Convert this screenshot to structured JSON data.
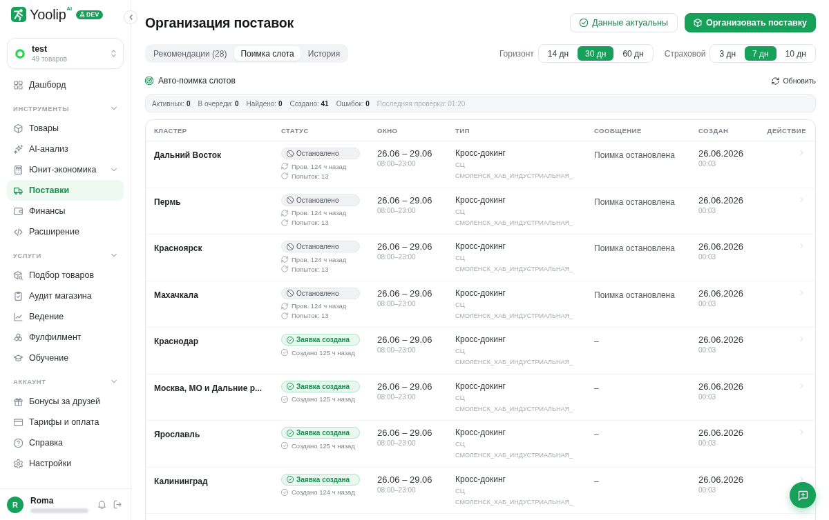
{
  "sidebar": {
    "brand": {
      "name": "Yoolip",
      "superscript": "AI",
      "badge": "DEV"
    },
    "workspace": {
      "name": "test",
      "subtitle": "49 товаров"
    },
    "nav": [
      {
        "kind": "link",
        "label": "Дашборд",
        "selected": false,
        "submenu": false
      },
      {
        "kind": "section",
        "title": "ИНСТРУМЕНТЫ",
        "expanded": true,
        "children": [
          {
            "label": "Товары",
            "selected": false,
            "submenu": false
          },
          {
            "label": "AI-анализ",
            "selected": false,
            "submenu": false
          },
          {
            "label": "Юнит-экономика",
            "selected": false,
            "submenu": true
          },
          {
            "label": "Поставки",
            "selected": true,
            "submenu": false
          },
          {
            "label": "Финансы",
            "selected": false,
            "submenu": false
          },
          {
            "label": "Расширение",
            "selected": false,
            "submenu": false
          }
        ]
      },
      {
        "kind": "section",
        "title": "УСЛУГИ",
        "expanded": true,
        "children": [
          {
            "label": "Подбор товаров",
            "selected": false,
            "submenu": false
          },
          {
            "label": "Аудит магазина",
            "selected": false,
            "submenu": false
          },
          {
            "label": "Ведение",
            "selected": false,
            "submenu": false
          },
          {
            "label": "Фулфилмент",
            "selected": false,
            "submenu": false
          },
          {
            "label": "Обучение",
            "selected": false,
            "submenu": false
          }
        ]
      },
      {
        "kind": "section",
        "title": "АККАУНТ",
        "expanded": true,
        "children": [
          {
            "label": "Бонусы за друзей",
            "selected": false,
            "submenu": false
          },
          {
            "label": "Тарифы и оплата",
            "selected": false,
            "submenu": false
          },
          {
            "label": "Справка",
            "selected": false,
            "submenu": false
          },
          {
            "label": "Настройки",
            "selected": false,
            "submenu": false
          }
        ]
      }
    ],
    "user": {
      "initial": "R",
      "name": "Roma"
    }
  },
  "header": {
    "title": "Организация поставок",
    "actions": [
      {
        "kind": "outline",
        "label": "Данные актуальны"
      },
      {
        "kind": "primary",
        "label": "Организовать поставку"
      }
    ]
  },
  "tabs": [
    {
      "label": "Рекомендации (28)",
      "selected": false
    },
    {
      "label": "Поимка слота",
      "selected": true
    },
    {
      "label": "История",
      "selected": false
    }
  ],
  "filters": [
    {
      "label": "Горизонт",
      "options": [
        {
          "label": "14 дн",
          "selected": false
        },
        {
          "label": "30 дн",
          "selected": true
        },
        {
          "label": "60 дн",
          "selected": false
        }
      ]
    },
    {
      "label": "Страховой",
      "options": [
        {
          "label": "3 дн",
          "selected": false
        },
        {
          "label": "7 дн",
          "selected": true
        },
        {
          "label": "10 дн",
          "selected": false
        }
      ]
    }
  ],
  "auto_catch": {
    "title": "Авто-поимка слотов",
    "refresh": "Обновить"
  },
  "stats": [
    {
      "kind": "count",
      "label": "Активных:",
      "value": "0"
    },
    {
      "kind": "count",
      "label": "В очереди:",
      "value": "0"
    },
    {
      "kind": "count",
      "label": "Найдено:",
      "value": "0"
    },
    {
      "kind": "count",
      "label": "Создано:",
      "value": "41"
    },
    {
      "kind": "count",
      "label": "Ошибок:",
      "value": "0"
    },
    {
      "kind": "note",
      "label": "Последняя проверка:",
      "value": "01:20"
    }
  ],
  "table": {
    "columns": [
      "КЛАСТЕР",
      "СТАТУС",
      "ОКНО",
      "ТИП",
      "СООБЩЕНИЕ",
      "СОЗДАН",
      "ДЕЙСТВИЕ"
    ],
    "rows": [
      {
        "cluster": "Дальний Восток",
        "status": {
          "kind": "stopped",
          "label": "Остановлено",
          "details": [
            {
              "kind": "checked",
              "text": "Пров. 124 ч назад"
            },
            {
              "kind": "attempts",
              "text": "Попыток: 13"
            }
          ]
        },
        "window": {
          "dates": "26.06 – 29.06",
          "hours": "08:00–23:00"
        },
        "type": {
          "name": "Кросс-докинг",
          "category": "СЦ",
          "warehouse": "СМОЛЕНСК_ХАБ_ИНДУСТРИАЛЬНАЯ_"
        },
        "message": "Поимка остановлена",
        "created": {
          "date": "26.06.2026",
          "time": "00:03"
        }
      },
      {
        "cluster": "Пермь",
        "status": {
          "kind": "stopped",
          "label": "Остановлено",
          "details": [
            {
              "kind": "checked",
              "text": "Пров. 124 ч назад"
            },
            {
              "kind": "attempts",
              "text": "Попыток: 13"
            }
          ]
        },
        "window": {
          "dates": "26.06 – 29.06",
          "hours": "08:00–23:00"
        },
        "type": {
          "name": "Кросс-докинг",
          "category": "СЦ",
          "warehouse": "СМОЛЕНСК_ХАБ_ИНДУСТРИАЛЬНАЯ_"
        },
        "message": "Поимка остановлена",
        "created": {
          "date": "26.06.2026",
          "time": "00:03"
        }
      },
      {
        "cluster": "Красноярск",
        "status": {
          "kind": "stopped",
          "label": "Остановлено",
          "details": [
            {
              "kind": "checked",
              "text": "Пров. 124 ч назад"
            },
            {
              "kind": "attempts",
              "text": "Попыток: 13"
            }
          ]
        },
        "window": {
          "dates": "26.06 – 29.06",
          "hours": "08:00–23:00"
        },
        "type": {
          "name": "Кросс-докинг",
          "category": "СЦ",
          "warehouse": "СМОЛЕНСК_ХАБ_ИНДУСТРИАЛЬНАЯ_"
        },
        "message": "Поимка остановлена",
        "created": {
          "date": "26.06.2026",
          "time": "00:03"
        }
      },
      {
        "cluster": "Махачкала",
        "status": {
          "kind": "stopped",
          "label": "Остановлено",
          "details": [
            {
              "kind": "checked",
              "text": "Пров. 124 ч назад"
            },
            {
              "kind": "attempts",
              "text": "Попыток: 13"
            }
          ]
        },
        "window": {
          "dates": "26.06 – 29.06",
          "hours": "08:00–23:00"
        },
        "type": {
          "name": "Кросс-докинг",
          "category": "СЦ",
          "warehouse": "СМОЛЕНСК_ХАБ_ИНДУСТРИАЛЬНАЯ_"
        },
        "message": "Поимка остановлена",
        "created": {
          "date": "26.06.2026",
          "time": "00:03"
        }
      },
      {
        "cluster": "Краснодар",
        "status": {
          "kind": "created",
          "label": "Заявка создана",
          "details": [
            {
              "kind": "created",
              "text": "Создано 125 ч назад"
            }
          ]
        },
        "window": {
          "dates": "26.06 – 29.06",
          "hours": "08:00–23:00"
        },
        "type": {
          "name": "Кросс-докинг",
          "category": "СЦ",
          "warehouse": "СМОЛЕНСК_ХАБ_ИНДУСТРИАЛЬНАЯ_"
        },
        "message": "–",
        "created": {
          "date": "26.06.2026",
          "time": "00:03"
        }
      },
      {
        "cluster": "Москва, МО и Дальние р...",
        "status": {
          "kind": "created",
          "label": "Заявка создана",
          "details": [
            {
              "kind": "created",
              "text": "Создано 125 ч назад"
            }
          ]
        },
        "window": {
          "dates": "26.06 – 29.06",
          "hours": "08:00–23:00"
        },
        "type": {
          "name": "Кросс-докинг",
          "category": "СЦ",
          "warehouse": "СМОЛЕНСК_ХАБ_ИНДУСТРИАЛЬНАЯ_"
        },
        "message": "–",
        "created": {
          "date": "26.06.2026",
          "time": "00:03"
        }
      },
      {
        "cluster": "Ярославль",
        "status": {
          "kind": "created",
          "label": "Заявка создана",
          "details": [
            {
              "kind": "created",
              "text": "Создано 125 ч назад"
            }
          ]
        },
        "window": {
          "dates": "26.06 – 29.06",
          "hours": "08:00–23:00"
        },
        "type": {
          "name": "Кросс-докинг",
          "category": "СЦ",
          "warehouse": "СМОЛЕНСК_ХАБ_ИНДУСТРИАЛЬНАЯ_"
        },
        "message": "–",
        "created": {
          "date": "26.06.2026",
          "time": "00:03"
        }
      },
      {
        "cluster": "Калининград",
        "status": {
          "kind": "created",
          "label": "Заявка создана",
          "details": [
            {
              "kind": "created",
              "text": "Создано 124 ч назад"
            }
          ]
        },
        "window": {
          "dates": "26.06 – 29.06",
          "hours": "08:00–23:00"
        },
        "type": {
          "name": "Кросс-докинг",
          "category": "СЦ",
          "warehouse": "СМОЛЕНСК_ХАБ_ИНДУСТРИАЛЬНАЯ_"
        },
        "message": "–",
        "created": {
          "date": "26.06.2026",
          "time": "00:03"
        }
      }
    ]
  }
}
